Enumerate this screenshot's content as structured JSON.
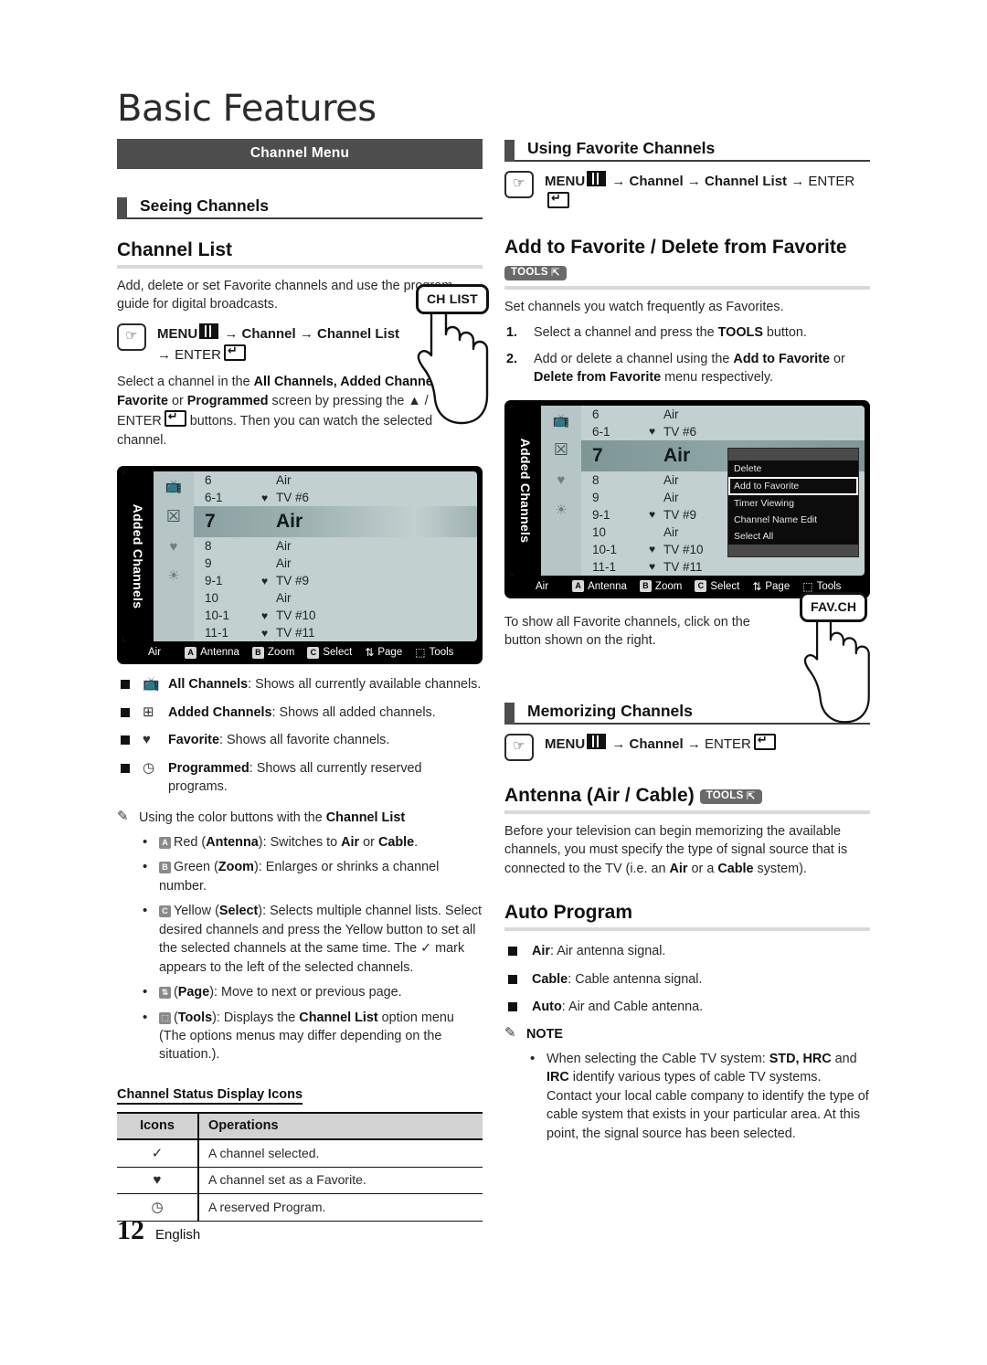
{
  "page": {
    "title": "Basic Features",
    "footer_page_number": "12",
    "footer_language": "English"
  },
  "left": {
    "menu_banner": "Channel Menu",
    "section_heading": "Seeing Channels",
    "h2_channel_list": "Channel List",
    "intro": "Add, delete or set Favorite channels and use the program guide for digital broadcasts.",
    "path_menu": "MENU",
    "path_parts": [
      "Channel",
      "Channel List"
    ],
    "path_enter": "ENTER",
    "select_text_1": "Select a channel in the ",
    "select_bold_1": "All Channels, Added Channels, Favorite",
    "select_text_2": " or ",
    "select_bold_2": "Programmed",
    "select_text_3": " screen by pressing the ▲ / ▼ and ENTER",
    "select_text_4": " buttons. Then you can watch the selected channel.",
    "ch_list_button": "CH LIST",
    "types": [
      {
        "icon": "all-channels-icon",
        "glyph": "📺",
        "label": "All Channels",
        "desc": ": Shows all currently available channels."
      },
      {
        "icon": "added-channels-icon",
        "glyph": "⊞",
        "label": "Added Channels",
        "desc": ": Shows all added channels."
      },
      {
        "icon": "favorite-heart-icon",
        "glyph": "♥",
        "label": "Favorite",
        "desc": ": Shows all favorite channels."
      },
      {
        "icon": "programmed-clock-icon",
        "glyph": "◷",
        "label": "Programmed",
        "desc": ": Shows all currently reserved programs."
      }
    ],
    "color_buttons_head": "Using the color buttons with the ",
    "color_buttons_head_bold": "Channel List",
    "color_buttons": [
      {
        "key": "A",
        "name": "Red",
        "paren": "Antenna",
        "desc": ": Switches to ",
        "bold_a": "Air",
        "mid": " or ",
        "bold_b": "Cable",
        "tail": "."
      },
      {
        "key": "B",
        "name": "Green",
        "paren": "Zoom",
        "desc": ": Enlarges or shrinks a channel number.",
        "bold_a": "",
        "mid": "",
        "bold_b": "",
        "tail": ""
      },
      {
        "key": "C",
        "name": "Yellow",
        "paren": "Select",
        "desc": ": Selects multiple channel lists. Select desired channels and press the Yellow button to set all the selected channels at the same time. The ✓ mark appears to the left of the selected channels.",
        "bold_a": "",
        "mid": "",
        "bold_b": "",
        "tail": ""
      },
      {
        "key": "⇅",
        "name": "",
        "paren": "Page",
        "desc": ": Move to next or previous page.",
        "bold_a": "",
        "mid": "",
        "bold_b": "",
        "tail": ""
      },
      {
        "key": "⬚",
        "name": "",
        "paren": "Tools",
        "desc": ": Displays the ",
        "bold_a": "Channel List",
        "mid": " option menu (The options menus may differ depending on the situation.).",
        "bold_b": "",
        "tail": ""
      }
    ],
    "table_title": "Channel Status Display Icons",
    "table_headers": [
      "Icons",
      "Operations"
    ],
    "table_rows": [
      {
        "icon": "✓",
        "icon_name": "check-icon",
        "operation": "A channel selected."
      },
      {
        "icon": "♥",
        "icon_name": "heart-icon",
        "operation": "A channel set as a Favorite."
      },
      {
        "icon": "◷",
        "icon_name": "clock-icon",
        "operation": "A reserved Program."
      }
    ]
  },
  "right": {
    "section_heading_fav": "Using Favorite Channels",
    "path_fav_menu": "MENU",
    "path_fav_parts": [
      "Channel",
      "Channel List"
    ],
    "path_fav_enter": "ENTER",
    "h2_add_fav": "Add to Favorite / Delete from Favorite",
    "tools_badge": "TOOLS",
    "add_fav_intro": "Set channels you watch frequently as Favorites.",
    "add_fav_steps": [
      "Select a channel and press the TOOLS button.",
      "Add or delete a channel using the Add to Favorite or Delete from Favorite menu respectively."
    ],
    "fav_show_text": "To show all Favorite channels, click on the button shown on the right.",
    "fav_ch_button": "FAV.CH",
    "section_heading_memorizing": "Memorizing Channels",
    "path_mem_menu": "MENU",
    "path_mem_parts": [
      "Channel"
    ],
    "path_mem_enter": "ENTER",
    "h2_antenna": "Antenna (Air / Cable)",
    "antenna_body_1": "Before your television can begin memorizing the available channels, you must specify the type of signal source that is connected to the TV (i.e. an ",
    "antenna_bold_1": "Air",
    "antenna_body_2": " or a ",
    "antenna_bold_2": "Cable",
    "antenna_body_3": " system).",
    "h2_auto_program": "Auto Program",
    "auto_program_items": [
      {
        "label": "Air",
        "desc": ": Air antenna signal."
      },
      {
        "label": "Cable",
        "desc": ": Cable antenna signal."
      },
      {
        "label": "Auto",
        "desc": ": Air and Cable antenna."
      }
    ],
    "note_label": "NOTE",
    "note_items": [
      {
        "text_1": "When selecting the Cable TV system: ",
        "bold_1": "STD, HRC",
        "text_2": " and ",
        "bold_2": "IRC",
        "text_3": " identify various types of cable TV systems. Contact your local cable company to identify the type of cable system that exists in your particular area. At this point, the signal source has been selected."
      }
    ]
  },
  "tv_screen_left": {
    "sidebar_label": "Added Channels",
    "rows": [
      {
        "num": "6",
        "heart": "",
        "name": "Air",
        "selected": false
      },
      {
        "num": "6-1",
        "heart": "♥",
        "name": "TV #6",
        "selected": false
      },
      {
        "num": "7",
        "heart": "",
        "name": "Air",
        "selected": true
      },
      {
        "num": "8",
        "heart": "",
        "name": "Air",
        "selected": false
      },
      {
        "num": "9",
        "heart": "",
        "name": "Air",
        "selected": false
      },
      {
        "num": "9-1",
        "heart": "♥",
        "name": "TV #9",
        "selected": false
      },
      {
        "num": "10",
        "heart": "",
        "name": "Air",
        "selected": false
      },
      {
        "num": "10-1",
        "heart": "♥",
        "name": "TV #10",
        "selected": false
      },
      {
        "num": "11-1",
        "heart": "♥",
        "name": "TV #11",
        "selected": false
      }
    ],
    "bar": {
      "source": "Air",
      "items": [
        {
          "key": "A",
          "label": "Antenna"
        },
        {
          "key": "B",
          "label": "Zoom"
        },
        {
          "key": "C",
          "label": "Select"
        },
        {
          "key": "⇅",
          "label": "Page"
        },
        {
          "key": "⬚",
          "label": "Tools"
        }
      ]
    }
  },
  "tv_screen_right": {
    "sidebar_label": "Added Channels",
    "rows": [
      {
        "num": "6",
        "heart": "",
        "name": "Air",
        "selected": false
      },
      {
        "num": "6-1",
        "heart": "♥",
        "name": "TV #6",
        "selected": false
      },
      {
        "num": "7",
        "heart": "",
        "name": "Air",
        "selected": true
      },
      {
        "num": "8",
        "heart": "",
        "name": "Air",
        "selected": false
      },
      {
        "num": "9",
        "heart": "",
        "name": "Air",
        "selected": false
      },
      {
        "num": "9-1",
        "heart": "♥",
        "name": "TV #9",
        "selected": false
      },
      {
        "num": "10",
        "heart": "",
        "name": "Air",
        "selected": false
      },
      {
        "num": "10-1",
        "heart": "♥",
        "name": "TV #10",
        "selected": false
      },
      {
        "num": "11-1",
        "heart": "♥",
        "name": "TV #11",
        "selected": false
      }
    ],
    "dropdown": [
      {
        "label": "Delete",
        "highlighted": false
      },
      {
        "label": "Add to Favorite",
        "highlighted": true
      },
      {
        "label": "Timer Viewing",
        "highlighted": false
      },
      {
        "label": "Channel Name Edit",
        "highlighted": false
      },
      {
        "label": "Select All",
        "highlighted": false
      }
    ],
    "bar": {
      "source": "Air",
      "items": [
        {
          "key": "A",
          "label": "Antenna"
        },
        {
          "key": "B",
          "label": "Zoom"
        },
        {
          "key": "C",
          "label": "Select"
        },
        {
          "key": "⇅",
          "label": "Page"
        },
        {
          "key": "⬚",
          "label": "Tools"
        }
      ]
    }
  },
  "colors": {
    "banner_bg": "#4d4d4d",
    "tools_badge_bg": "#6a6a6a",
    "rule": "#d9d9d9",
    "tv_bg": "#c3d0d0",
    "tv_selected": "#8aa0a0",
    "table_header_bg": "#d2d2d2"
  }
}
